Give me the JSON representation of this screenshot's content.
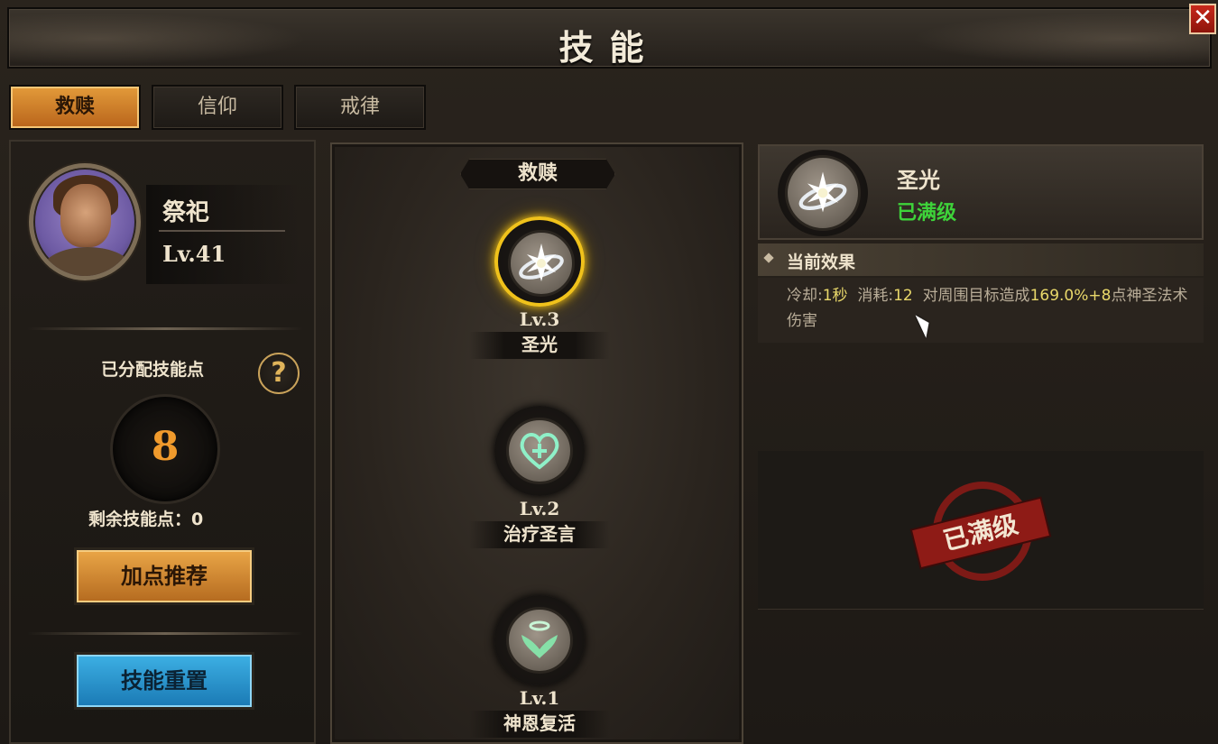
{
  "window": {
    "title": "技能",
    "close_glyph": "✕"
  },
  "tabs": [
    {
      "label": "救赎",
      "active": true
    },
    {
      "label": "信仰",
      "active": false
    },
    {
      "label": "戒律",
      "active": false
    }
  ],
  "character": {
    "name": "祭祀",
    "level": "Lv.41"
  },
  "points": {
    "allocated_label": "已分配技能点",
    "help_glyph": "?",
    "allocated_value": "8",
    "remaining_label": "剩余技能点：0"
  },
  "buttons": {
    "recommend": "加点推荐",
    "reset": "技能重置"
  },
  "tree": {
    "title": "救赎",
    "skills": [
      {
        "level": "Lv.3",
        "name": "圣光",
        "icon": "holy-light-icon",
        "selected": true
      },
      {
        "level": "Lv.2",
        "name": "治疗圣言",
        "icon": "heal-heart-icon",
        "selected": false
      },
      {
        "level": "Lv.1",
        "name": "神恩复活",
        "icon": "resurrection-wings-icon",
        "selected": false
      }
    ]
  },
  "detail": {
    "name": "圣光",
    "status": "已满级",
    "effect_title": "当前效果",
    "effect_parts": {
      "cd_label": "冷却:",
      "cd_value": "1秒",
      "cost_label": "消耗:",
      "cost_value": "12",
      "desc_prefix": "对周围目标造成",
      "desc_value": "169.0%+8",
      "desc_suffix": "点神圣法术伤害"
    },
    "stamp_text": "已满级"
  },
  "colors": {
    "accent_orange": "#e39b3a",
    "selected_gold": "#f0c21b",
    "max_green": "#3ed33a",
    "stamp_red": "#8e1b16",
    "reset_blue": "#3db0e4"
  }
}
